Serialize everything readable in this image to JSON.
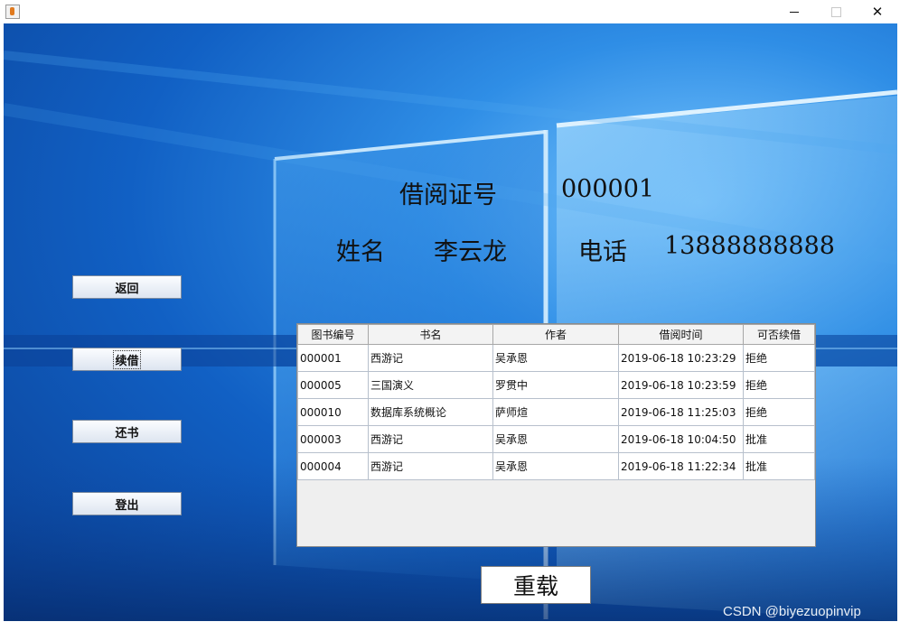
{
  "window": {
    "minimize_glyph": "",
    "close_glyph": "✕"
  },
  "card": {
    "card_label": "借阅证号",
    "card_value": "000001",
    "name_label": "姓名",
    "name_value": "李云龙",
    "phone_label": "电话",
    "phone_value": "13888888888"
  },
  "buttons": {
    "back": "返回",
    "renew": "续借",
    "return_book": "还书",
    "logout": "登出",
    "reload": "重载"
  },
  "table": {
    "columns": [
      "图书编号",
      "书名",
      "作者",
      "借阅时间",
      "可否续借"
    ],
    "rows": [
      [
        "000001",
        "西游记",
        "吴承恩",
        "2019-06-18 10:23:29",
        "拒绝"
      ],
      [
        "000005",
        "三国演义",
        "罗贯中",
        "2019-06-18 10:23:59",
        "拒绝"
      ],
      [
        "000010",
        "数据库系统概论",
        "萨师煊",
        "2019-06-18 11:25:03",
        "拒绝"
      ],
      [
        "000003",
        "西游记",
        "吴承恩",
        "2019-06-18 10:04:50",
        "批准"
      ],
      [
        "000004",
        "西游记",
        "吴承恩",
        "2019-06-18 11:22:34",
        "批准"
      ]
    ]
  },
  "watermark": "CSDN @biyezuopinvip",
  "colors": {
    "bg_dark": "#0a3e91",
    "bg_mid": "#1160c4",
    "bg_light": "#7cc8ff"
  },
  "icons": {
    "app": "java-cup-icon",
    "minimize": "minimize-icon",
    "maximize": "maximize-icon",
    "close": "close-icon"
  }
}
